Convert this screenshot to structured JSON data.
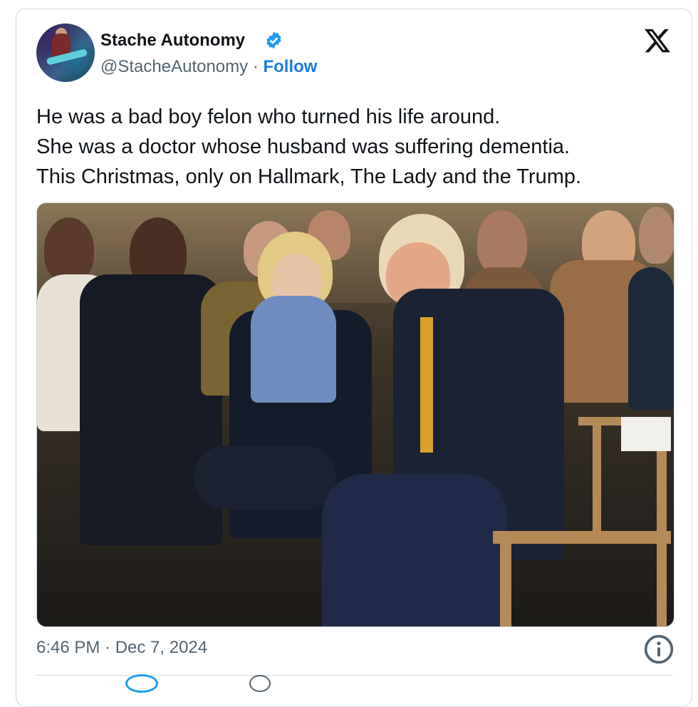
{
  "author": {
    "name": "Stache Autonomy",
    "handle": "@StacheAutonomy",
    "separator": "·",
    "follow_label": "Follow"
  },
  "brand": {
    "logo": "x-logo-icon",
    "verified_color": "#1d9bf0",
    "accent": "#1d7bd8"
  },
  "tweet": {
    "lines": [
      "He was a bad boy felon who turned his life around.",
      "She was a doctor whose husband was suffering dementia.",
      "This Christmas, only on Hallmark, The Lady and the Trump."
    ]
  },
  "footer": {
    "timestamp": "6:46 PM · Dec 7, 2024",
    "info_icon": "info-icon"
  }
}
